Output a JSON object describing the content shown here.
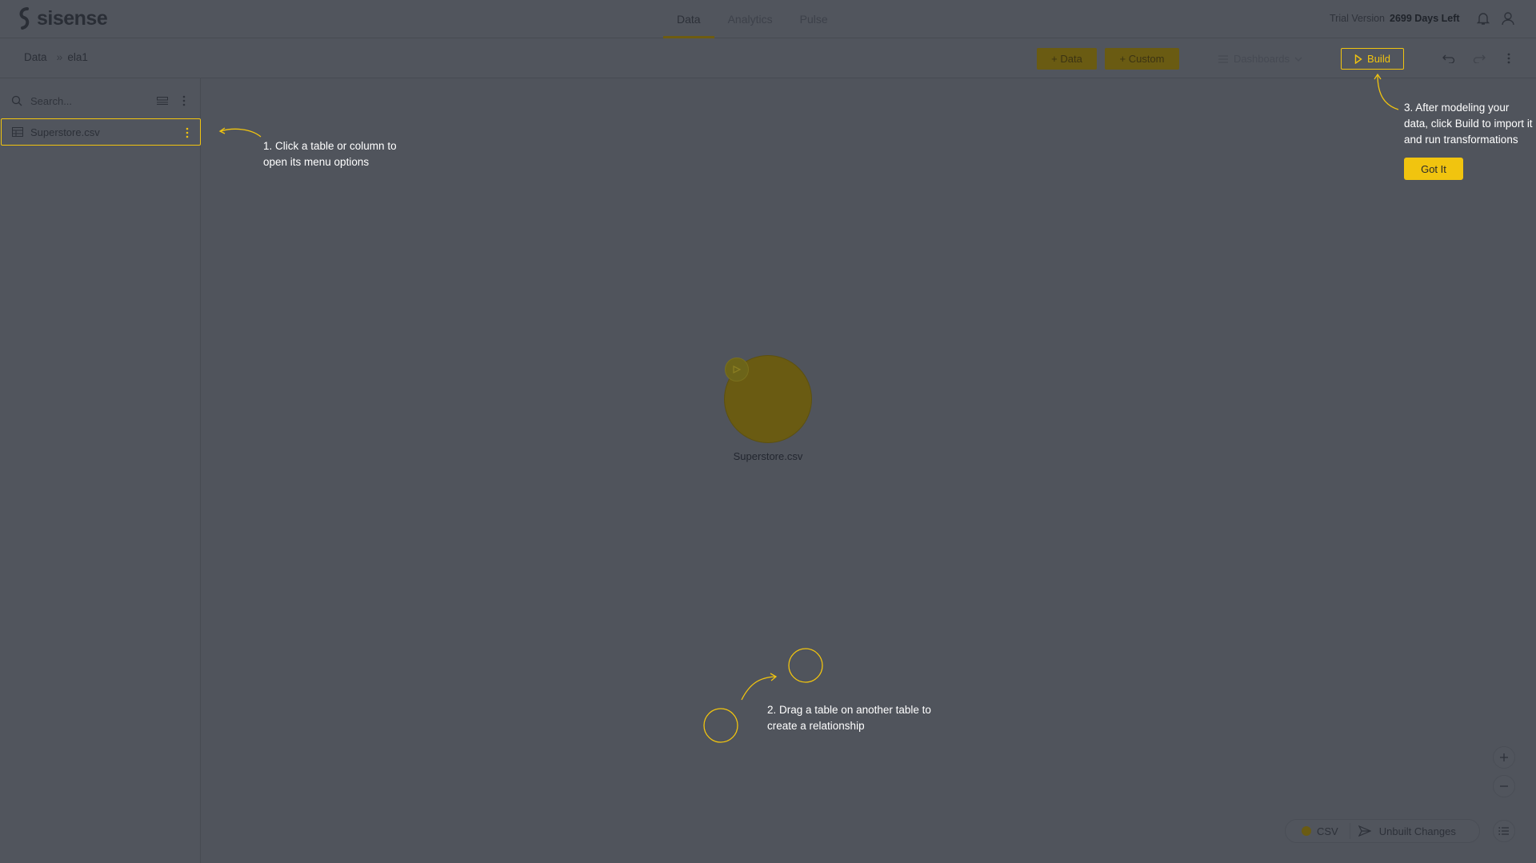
{
  "header": {
    "logo_text": "sisense",
    "nav": [
      {
        "label": "Data",
        "active": true
      },
      {
        "label": "Analytics",
        "active": false
      },
      {
        "label": "Pulse",
        "active": false
      }
    ],
    "trial_label": "Trial Version",
    "trial_days": "2699 Days Left"
  },
  "toolbar": {
    "breadcrumb_root": "Data",
    "breadcrumb_sep": "»",
    "breadcrumb_current": "ela1",
    "add_data_label": "+ Data",
    "add_custom_label": "+ Custom",
    "dashboards_label": "Dashboards",
    "build_label": "Build"
  },
  "sidebar": {
    "search_placeholder": "Search...",
    "tables": [
      {
        "label": "Superstore.csv"
      }
    ]
  },
  "canvas": {
    "node_label": "Superstore.csv",
    "hint1": "1. Click a table or column to open its menu options",
    "hint2": "2. Drag a table on another table to create a relationship",
    "hint3": "3. After modeling your data, click Build to import it and run transformations",
    "got_it_label": "Got It"
  },
  "status": {
    "source_label": "CSV",
    "changes_label": "Unbuilt Changes"
  },
  "colors": {
    "accent": "#f1c40f",
    "overlay_bg": "#50545c",
    "dim_gold": "#6a5b12"
  }
}
